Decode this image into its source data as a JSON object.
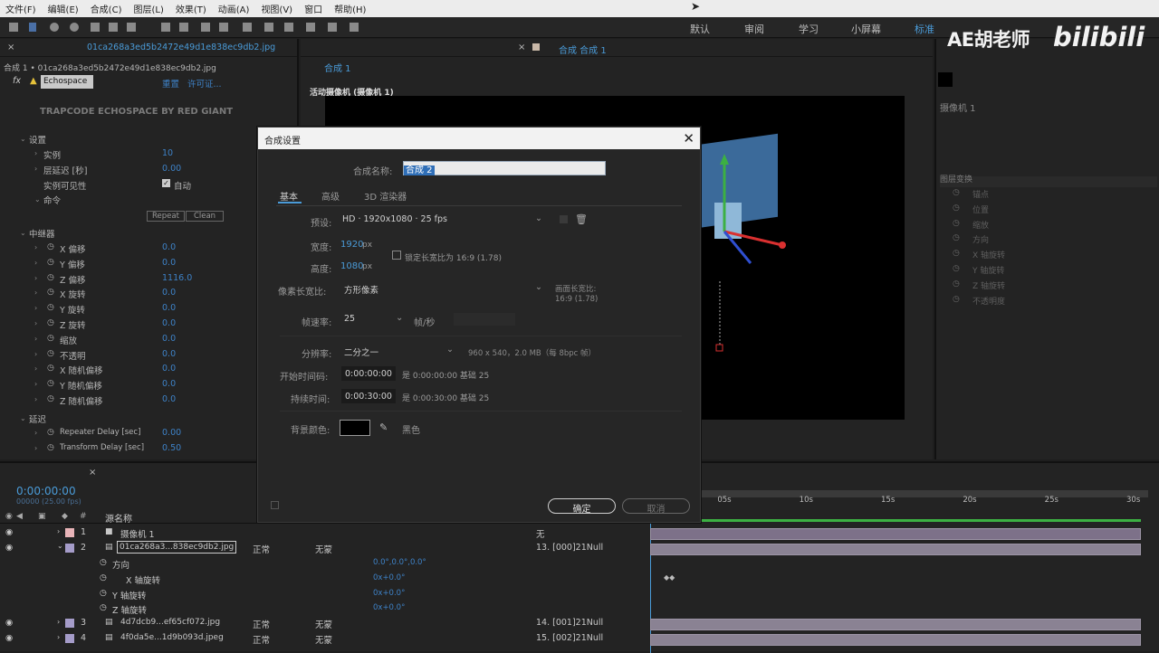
{
  "menu": [
    "文件(F)",
    "编辑(E)",
    "合成(C)",
    "图层(L)",
    "效果(T)",
    "动画(A)",
    "视图(V)",
    "窗口",
    "帮助(H)"
  ],
  "workspaces": [
    "默认",
    "审阅",
    "学习",
    "小屏幕",
    "标准"
  ],
  "watermark": "AE胡老师",
  "bili": "bilibili",
  "fx": {
    "tab": "01ca268a3ed5b2472e49d1e838ec9db2.jpg",
    "breadcrumb": "合成 1 • 01ca268a3ed5b2472e49d1e838ec9db2.jpg",
    "effect_name": "Echospace",
    "reset": "重置",
    "license": "许可证...",
    "brand": "TRAPCODE ECHOSPACE BY RED GIANT",
    "settings": "设置",
    "instances": "实例",
    "instances_val": "10",
    "delay": "层延迟 [秒]",
    "delay_val": "0.00",
    "visible": "实例可见性",
    "visible_val": "自动",
    "command": "命令",
    "repeat_btn": "Repeat",
    "clean_btn": "Clean",
    "repeater": "中继器",
    "props": [
      {
        "label": "X 偏移",
        "val": "0.0"
      },
      {
        "label": "Y 偏移",
        "val": "0.0"
      },
      {
        "label": "Z 偏移",
        "val": "1116.0"
      },
      {
        "label": "X 旋转",
        "val": "0.0"
      },
      {
        "label": "Y 旋转",
        "val": "0.0"
      },
      {
        "label": "Z 旋转",
        "val": "0.0"
      },
      {
        "label": "缩放",
        "val": "0.0"
      },
      {
        "label": "不透明",
        "val": "0.0"
      },
      {
        "label": "X 随机偏移",
        "val": "0.0"
      },
      {
        "label": "Y 随机偏移",
        "val": "0.0"
      },
      {
        "label": "Z 随机偏移",
        "val": "0.0"
      }
    ],
    "delay_group": "延迟",
    "rep_delay": "Repeater Delay [sec]",
    "rep_delay_val": "0.00",
    "tr_delay": "Transform Delay [sec]",
    "tr_delay_val": "0.50"
  },
  "viewer": {
    "tab": "合成 合成 1",
    "subtab": "合成 1",
    "camera": "活动摄像机 (摄像机 1)"
  },
  "dialog": {
    "title": "合成设置",
    "name_label": "合成名称:",
    "name_value": "合成 2",
    "tabs": [
      "基本",
      "高级",
      "3D 渲染器"
    ],
    "preset_label": "预设:",
    "preset_value": "HD · 1920x1080 · 25 fps",
    "width_label": "宽度:",
    "width_value": "1920",
    "height_label": "高度:",
    "height_value": "1080",
    "unit_px": "px",
    "lock_label": "锁定长宽比为 16:9 (1.78)",
    "par_label": "像素长宽比:",
    "par_value": "方形像素",
    "frame_aspect_label": "画面长宽比:",
    "frame_aspect_value": "16:9 (1.78)",
    "fps_label": "帧速率:",
    "fps_value": "25",
    "fps_unit": "帧/秒",
    "res_label": "分辨率:",
    "res_value": "二分之一",
    "res_info": "960 x 540，2.0 MB（每 8bpc 帧）",
    "start_label": "开始时间码:",
    "start_value": "0:00:00:00",
    "start_info": "是 0:00:00:00 基础 25",
    "dur_label": "持续时间:",
    "dur_value": "0:00:30:00",
    "dur_info": "是 0:00:30:00 基础 25",
    "bg_label": "背景颜色:",
    "bg_color_name": "黑色",
    "bg_color": "#000000",
    "ok": "确定",
    "cancel": "取消"
  },
  "timeline": {
    "timecode": "0:00:00:00",
    "fps_hint": "00000 (25.00 fps)",
    "col_source": "源名称",
    "ticks": [
      "05s",
      "10s",
      "15s",
      "20s",
      "25s",
      "30s"
    ],
    "layers": [
      {
        "num": "1",
        "name": "摄像机 1",
        "parent": "无"
      },
      {
        "num": "2",
        "name": "01ca268a3...838ec9db2.jpg",
        "mode": "正常",
        "track": "无蒙",
        "parent": "13. [000]21Null"
      }
    ],
    "subprops": [
      {
        "label": "方向",
        "val": "0.0°,0.0°,0.0°"
      },
      {
        "label": "X 轴旋转",
        "val": "0x+0.0°"
      },
      {
        "label": "Y 轴旋转",
        "val": "0x+0.0°"
      },
      {
        "label": "Z 轴旋转",
        "val": "0x+0.0°"
      }
    ],
    "layers2": [
      {
        "num": "3",
        "name": "4d7dcb9...ef65cf072.jpg",
        "mode": "正常",
        "track": "无蒙",
        "parent": "14. [001]21Null"
      },
      {
        "num": "4",
        "name": "4f0da5e...1d9b093d.jpeg",
        "mode": "正常",
        "track": "无蒙",
        "parent": "15. [002]21Null"
      }
    ]
  },
  "right": {
    "layer_name": "摄像机 1",
    "transform": "图层变换",
    "props": [
      "锚点",
      "位置",
      "缩放",
      "方向",
      "X 轴旋转",
      "Y 轴旋转",
      "Z 轴旋转",
      "不透明度"
    ]
  }
}
